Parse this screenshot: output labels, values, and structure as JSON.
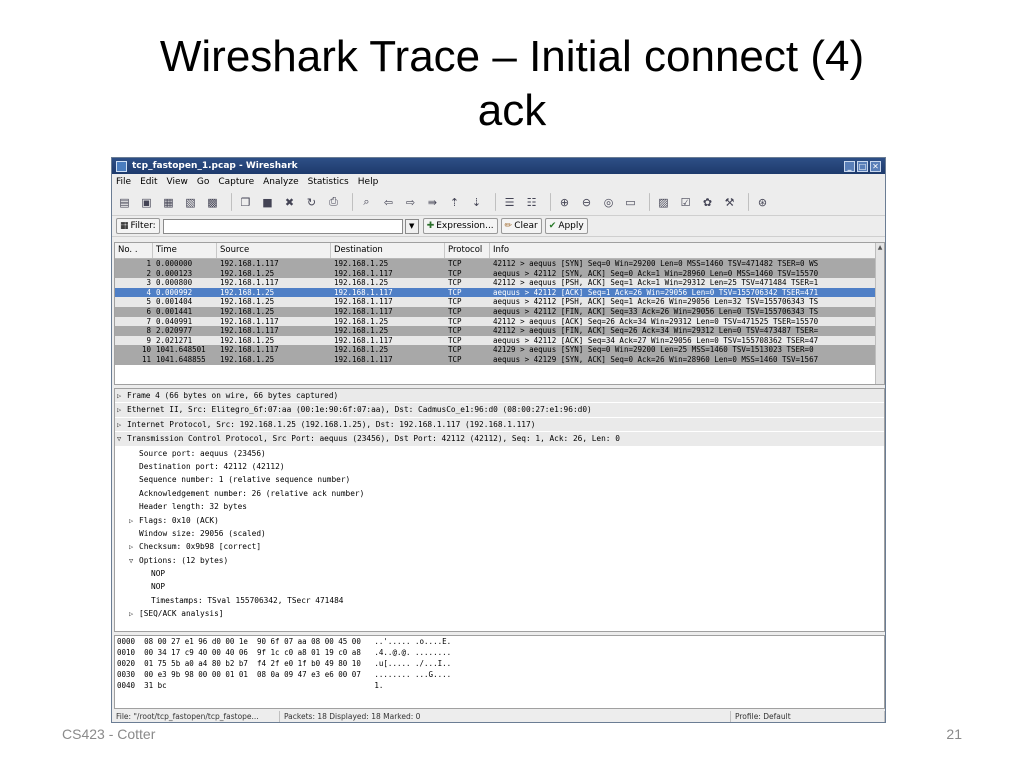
{
  "slide": {
    "title_line1": "Wireshark Trace – Initial connect (4)",
    "title_line2": "ack",
    "footer_left": "CS423 - Cotter",
    "footer_right": "21"
  },
  "window": {
    "title": "tcp_fastopen_1.pcap - Wireshark",
    "controls": [
      "_",
      "□",
      "✕"
    ]
  },
  "menu": [
    "File",
    "Edit",
    "View",
    "Go",
    "Capture",
    "Analyze",
    "Statistics",
    "Help"
  ],
  "toolbar_icons": [
    "interface-list-icon",
    "capture-options-icon",
    "start-capture-icon",
    "stop-capture-icon",
    "restart-capture-icon",
    "open-file-icon",
    "save-file-icon",
    "close-file-icon",
    "reload-icon",
    "print-icon",
    "find-packet-icon",
    "go-back-icon",
    "go-forward-icon",
    "go-to-packet-icon",
    "go-first-icon",
    "go-last-icon",
    "colorize-icon",
    "auto-scroll-icon",
    "zoom-in-icon",
    "zoom-out-icon",
    "zoom-normal-icon",
    "resize-columns-icon",
    "capture-filters-icon",
    "display-filters-icon",
    "coloring-rules-icon",
    "preferences-icon",
    "help-icon"
  ],
  "filter": {
    "label": "Filter:",
    "value": "",
    "expression": "Expression...",
    "clear": "Clear",
    "apply": "Apply"
  },
  "packet_list": {
    "columns": [
      "No. .",
      "Time",
      "Source",
      "Destination",
      "Protocol",
      "Info"
    ],
    "rows": [
      {
        "no": "1",
        "time": "0.000000",
        "src": "192.168.1.117",
        "dst": "192.168.1.25",
        "proto": "TCP",
        "info": "42112 > aequus [SYN] Seq=0 Win=29200 Len=0 MSS=1460 TSV=471482 TSER=0 WS",
        "bg": "#a8a8a8",
        "fg": "#000000"
      },
      {
        "no": "2",
        "time": "0.000123",
        "src": "192.168.1.25",
        "dst": "192.168.1.117",
        "proto": "TCP",
        "info": "aequus > 42112 [SYN, ACK] Seq=0 Ack=1 Win=28960 Len=0 MSS=1460 TSV=15570",
        "bg": "#a8a8a8",
        "fg": "#000000"
      },
      {
        "no": "3",
        "time": "0.000800",
        "src": "192.168.1.117",
        "dst": "192.168.1.25",
        "proto": "TCP",
        "info": "42112 > aequus [PSH, ACK] Seq=1 Ack=1 Win=29312 Len=25 TSV=471484 TSER=1",
        "bg": "#e8e8e8",
        "fg": "#000000"
      },
      {
        "no": "4",
        "time": "0.000992",
        "src": "192.168.1.25",
        "dst": "192.168.1.117",
        "proto": "TCP",
        "info": "aequus > 42112 [ACK] Seq=1 Ack=26 Win=29056 Len=0 TSV=155706342 TSER=471",
        "bg": "#4f7fc6",
        "fg": "#ffffff"
      },
      {
        "no": "5",
        "time": "0.001404",
        "src": "192.168.1.25",
        "dst": "192.168.1.117",
        "proto": "TCP",
        "info": "aequus > 42112 [PSH, ACK] Seq=1 Ack=26 Win=29056 Len=32 TSV=155706343 TS",
        "bg": "#e8e8e8",
        "fg": "#000000"
      },
      {
        "no": "6",
        "time": "0.001441",
        "src": "192.168.1.25",
        "dst": "192.168.1.117",
        "proto": "TCP",
        "info": "aequus > 42112 [FIN, ACK] Seq=33 Ack=26 Win=29056 Len=0 TSV=155706343 TS",
        "bg": "#a8a8a8",
        "fg": "#000000"
      },
      {
        "no": "7",
        "time": "0.040991",
        "src": "192.168.1.117",
        "dst": "192.168.1.25",
        "proto": "TCP",
        "info": "42112 > aequus [ACK] Seq=26 Ack=34 Win=29312 Len=0 TSV=471525 TSER=15570",
        "bg": "#e8e8e8",
        "fg": "#000000"
      },
      {
        "no": "8",
        "time": "2.020977",
        "src": "192.168.1.117",
        "dst": "192.168.1.25",
        "proto": "TCP",
        "info": "42112 > aequus [FIN, ACK] Seq=26 Ack=34 Win=29312 Len=0 TSV=473487 TSER=",
        "bg": "#a8a8a8",
        "fg": "#000000"
      },
      {
        "no": "9",
        "time": "2.021271",
        "src": "192.168.1.25",
        "dst": "192.168.1.117",
        "proto": "TCP",
        "info": "aequus > 42112 [ACK] Seq=34 Ack=27 Win=29056 Len=0 TSV=155708362 TSER=47",
        "bg": "#e8e8e8",
        "fg": "#000000"
      },
      {
        "no": "10",
        "time": "1041.648501",
        "src": "192.168.1.117",
        "dst": "192.168.1.25",
        "proto": "TCP",
        "info": "42129 > aequus [SYN] Seq=0 Win=29200 Len=25 MSS=1460 TSV=1513023 TSER=0",
        "bg": "#a8a8a8",
        "fg": "#000000"
      },
      {
        "no": "11",
        "time": "1041.648855",
        "src": "192.168.1.25",
        "dst": "192.168.1.117",
        "proto": "TCP",
        "info": "aequus > 42129 [SYN, ACK] Seq=0 Ack=26 Win=28960 Len=0 MSS=1460 TSV=1567",
        "bg": "#a8a8a8",
        "fg": "#000000"
      }
    ]
  },
  "details": [
    {
      "indent": 0,
      "tri": "▷",
      "text": "Frame 4 (66 bytes on wire, 66 bytes captured)",
      "top": true
    },
    {
      "indent": 0,
      "tri": "▷",
      "text": "Ethernet II, Src: Elitegro_6f:07:aa (00:1e:90:6f:07:aa), Dst: CadmusCo_e1:96:d0 (08:00:27:e1:96:d0)",
      "top": true
    },
    {
      "indent": 0,
      "tri": "▷",
      "text": "Internet Protocol, Src: 192.168.1.25 (192.168.1.25), Dst: 192.168.1.117 (192.168.1.117)",
      "top": true
    },
    {
      "indent": 0,
      "tri": "▽",
      "text": "Transmission Control Protocol, Src Port: aequus (23456), Dst Port: 42112 (42112), Seq: 1, Ack: 26, Len: 0",
      "top": true
    },
    {
      "indent": 1,
      "tri": "",
      "text": "Source port: aequus (23456)",
      "top": false
    },
    {
      "indent": 1,
      "tri": "",
      "text": "Destination port: 42112 (42112)",
      "top": false
    },
    {
      "indent": 1,
      "tri": "",
      "text": "Sequence number: 1    (relative sequence number)",
      "top": false
    },
    {
      "indent": 1,
      "tri": "",
      "text": "Acknowledgement number: 26    (relative ack number)",
      "top": false
    },
    {
      "indent": 1,
      "tri": "",
      "text": "Header length: 32 bytes",
      "top": false
    },
    {
      "indent": 1,
      "tri": "▷",
      "text": "Flags: 0x10 (ACK)",
      "top": false
    },
    {
      "indent": 1,
      "tri": "",
      "text": "Window size: 29056 (scaled)",
      "top": false
    },
    {
      "indent": 1,
      "tri": "▷",
      "text": "Checksum: 0x9b98 [correct]",
      "top": false
    },
    {
      "indent": 1,
      "tri": "▽",
      "text": "Options: (12 bytes)",
      "top": false
    },
    {
      "indent": 2,
      "tri": "",
      "text": "NOP",
      "top": false
    },
    {
      "indent": 2,
      "tri": "",
      "text": "NOP",
      "top": false
    },
    {
      "indent": 2,
      "tri": "",
      "text": "Timestamps: TSval 155706342, TSecr 471484",
      "top": false
    },
    {
      "indent": 1,
      "tri": "▷",
      "text": "[SEQ/ACK analysis]",
      "top": false
    }
  ],
  "hex": [
    "0000  08 00 27 e1 96 d0 00 1e  90 6f 07 aa 08 00 45 00   ..'..... .o....E.",
    "0010  00 34 17 c9 40 00 40 06  9f 1c c0 a8 01 19 c0 a8   .4..@.@. ........",
    "0020  01 75 5b a0 a4 80 b2 b7  f4 2f e0 1f b0 49 80 10   .u[..... ./...I..",
    "0030  00 e3 9b 98 00 00 01 01  08 0a 09 47 e3 e6 00 07   ........ ...G....",
    "0040  31 bc                                              1."
  ],
  "status": {
    "file": "File: \"/root/tcp_fastopen/tcp_fastope...",
    "packets": "Packets: 18 Displayed: 18 Marked: 0",
    "profile": "Profile: Default"
  }
}
